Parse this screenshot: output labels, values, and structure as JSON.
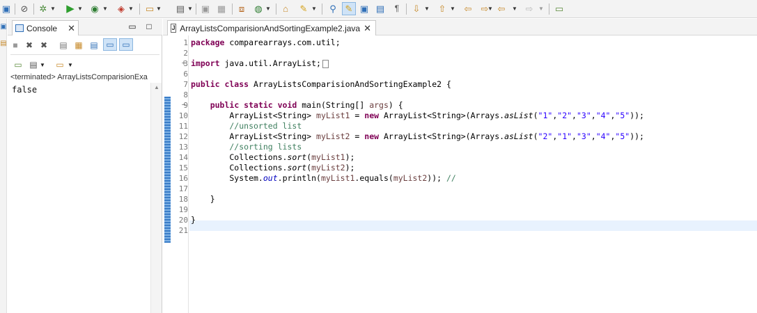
{
  "toolbar": {
    "icons": [
      "save-icon",
      "debug-icon",
      "run-icon",
      "coverage-icon",
      "external-tools-icon",
      "new-java-project-icon",
      "new-class-icon",
      "save-all-icon",
      "print-icon",
      "new-package-icon",
      "web-icon",
      "open-type-icon",
      "open-task-icon",
      "search-icon",
      "mark-occurrences-icon",
      "annotation-icon",
      "word-wrap-icon",
      "show-whitespace-icon",
      "next-annotation-icon",
      "previous-annotation-icon",
      "last-edit-icon",
      "back-icon",
      "forward-icon",
      "pin-editor-icon"
    ]
  },
  "console": {
    "tab_label": "Console",
    "status": "<terminated> ArrayListsComparisionExa",
    "output": "false"
  },
  "editor": {
    "tab_label": "ArrayListsComparisionAndSortingExample2.java",
    "lines": [
      {
        "n": "1",
        "segs": [
          [
            "kw",
            "package"
          ],
          [
            "",
            " comparearrays.com.util;"
          ]
        ]
      },
      {
        "n": "2",
        "segs": []
      },
      {
        "n": "3",
        "fold": "+",
        "segs": [
          [
            "kw",
            "import"
          ],
          [
            "",
            " java.util.ArrayList;"
          ],
          [
            "box",
            ""
          ]
        ]
      },
      {
        "n": "6",
        "segs": []
      },
      {
        "n": "7",
        "segs": [
          [
            "kw",
            "public class"
          ],
          [
            "",
            " ArrayListsComparisionAndSortingExample2 {"
          ]
        ]
      },
      {
        "n": "8",
        "segs": []
      },
      {
        "n": "9",
        "fold": "−",
        "segs": [
          [
            "",
            "    "
          ],
          [
            "kw",
            "public static void"
          ],
          [
            "",
            " main(String[] "
          ],
          [
            "var",
            "args"
          ],
          [
            "",
            ") {"
          ]
        ]
      },
      {
        "n": "10",
        "segs": [
          [
            "",
            "        ArrayList<String> "
          ],
          [
            "var",
            "myList1"
          ],
          [
            "",
            " = "
          ],
          [
            "kw",
            "new"
          ],
          [
            "",
            " ArrayList<String>(Arrays."
          ],
          [
            "st",
            "asList"
          ],
          [
            "",
            "("
          ],
          [
            "str",
            "\"1\""
          ],
          [
            "",
            ","
          ],
          [
            "str",
            "\"2\""
          ],
          [
            "",
            ","
          ],
          [
            "str",
            "\"3\""
          ],
          [
            "",
            ","
          ],
          [
            "str",
            "\"4\""
          ],
          [
            "",
            ","
          ],
          [
            "str",
            "\"5\""
          ],
          [
            "",
            "));"
          ]
        ]
      },
      {
        "n": "11",
        "segs": [
          [
            "cm",
            "        //unsorted list"
          ]
        ]
      },
      {
        "n": "12",
        "segs": [
          [
            "",
            "        ArrayList<String> "
          ],
          [
            "var",
            "myList2"
          ],
          [
            "",
            " = "
          ],
          [
            "kw",
            "new"
          ],
          [
            "",
            " ArrayList<String>(Arrays."
          ],
          [
            "st",
            "asList"
          ],
          [
            "",
            "("
          ],
          [
            "str",
            "\"2\""
          ],
          [
            "",
            ","
          ],
          [
            "str",
            "\"1\""
          ],
          [
            "",
            ","
          ],
          [
            "str",
            "\"3\""
          ],
          [
            "",
            ","
          ],
          [
            "str",
            "\"4\""
          ],
          [
            "",
            ","
          ],
          [
            "str",
            "\"5\""
          ],
          [
            "",
            "));"
          ]
        ]
      },
      {
        "n": "13",
        "segs": [
          [
            "cm",
            "        //sorting lists"
          ]
        ]
      },
      {
        "n": "14",
        "segs": [
          [
            "",
            "        Collections."
          ],
          [
            "st",
            "sort"
          ],
          [
            "",
            "("
          ],
          [
            "var",
            "myList1"
          ],
          [
            "",
            ");"
          ]
        ]
      },
      {
        "n": "15",
        "segs": [
          [
            "",
            "        Collections."
          ],
          [
            "st",
            "sort"
          ],
          [
            "",
            "("
          ],
          [
            "var",
            "myList2"
          ],
          [
            "",
            ");"
          ]
        ]
      },
      {
        "n": "16",
        "segs": [
          [
            "",
            "        System."
          ],
          [
            "fld",
            "out"
          ],
          [
            "",
            ".println("
          ],
          [
            "var",
            "myList1"
          ],
          [
            "",
            ".equals("
          ],
          [
            "var",
            "myList2"
          ],
          [
            "",
            ")); "
          ],
          [
            "cm",
            "//"
          ]
        ]
      },
      {
        "n": "17",
        "segs": []
      },
      {
        "n": "18",
        "segs": [
          [
            "",
            "    }"
          ]
        ]
      },
      {
        "n": "19",
        "segs": []
      },
      {
        "n": "20",
        "segs": [
          [
            "",
            "}"
          ]
        ]
      },
      {
        "n": "21",
        "segs": []
      }
    ]
  },
  "colors": {
    "keyword": "#7f0055",
    "string": "#2a00ff",
    "comment": "#3f7f5f",
    "field": "#0000c0",
    "current_line": "#e8f2fe",
    "marker": "#3a7dc8"
  }
}
